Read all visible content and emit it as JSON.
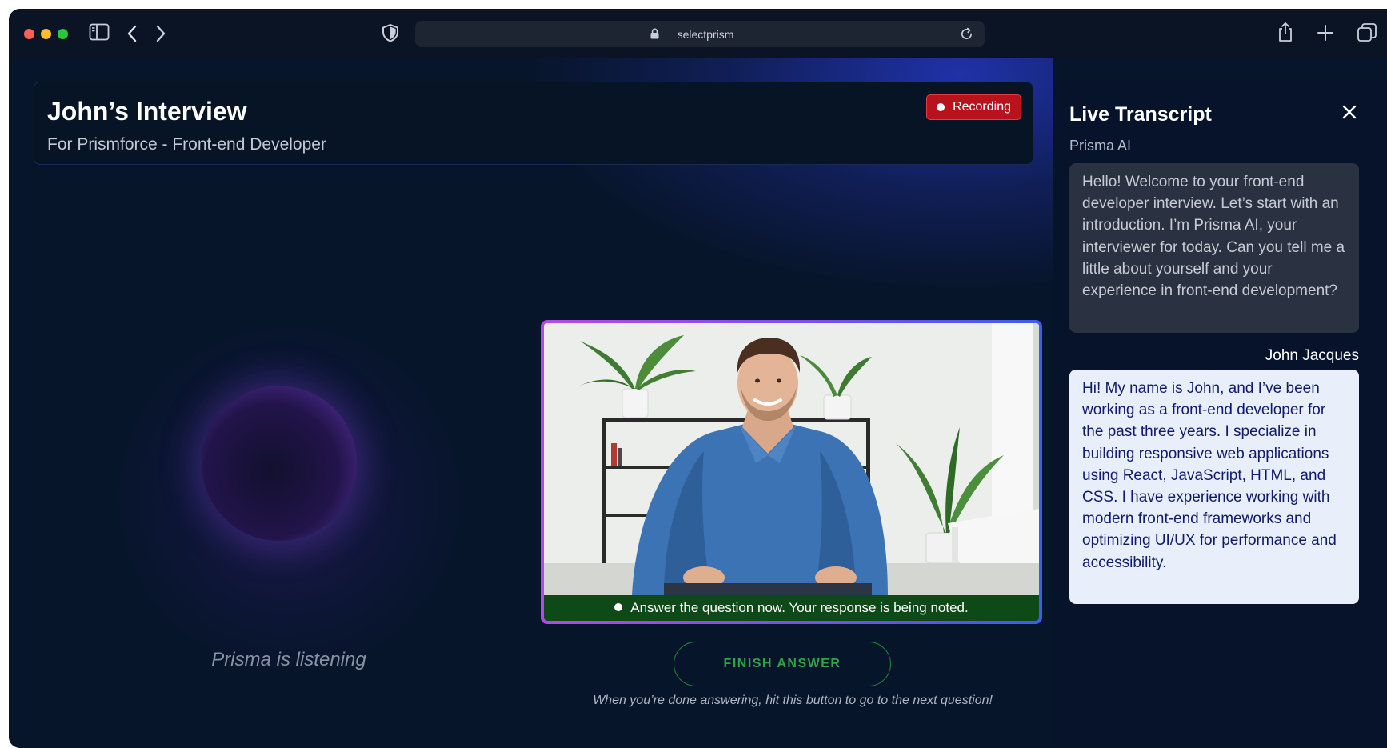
{
  "browser": {
    "url": "selectprism",
    "icons": [
      "sidebar-icon",
      "back-icon",
      "forward-icon",
      "shield-icon",
      "lock-icon",
      "reload-icon",
      "share-icon",
      "new-tab-icon",
      "tabs-icon"
    ]
  },
  "header": {
    "title": "John’s Interview",
    "subtitle": "For Prismforce - Front-end Developer",
    "recording_label": "Recording"
  },
  "assistant": {
    "status": "Prisma is listening"
  },
  "video": {
    "banner": "Answer the question now. Your response is being noted."
  },
  "actions": {
    "finish_label": "FINISH ANSWER",
    "finish_hint": "When you’re done answering, hit this button to go to the next question!"
  },
  "transcript": {
    "title": "Live Transcript",
    "messages": [
      {
        "speaker": "Prisma AI",
        "text": "Hello! Welcome to your front-end developer interview. Let’s start with an introduction. I’m Prisma AI, your interviewer for today. Can you tell me a little about yourself and your experience in front-end development?"
      },
      {
        "speaker": "John Jacques",
        "text": "Hi! My name is John, and I’ve been working as a front-end developer for the past three years. I specialize in building responsive web applications using React, JavaScript, HTML, and CSS. I have experience working with modern front-end frameworks and optimizing UI/UX for performance and accessibility."
      }
    ]
  },
  "colors": {
    "background": "#07152b",
    "recording": "#b8121d",
    "accent_green": "#2fa347",
    "frame_gradient_start": "#b24be6",
    "frame_gradient_end": "#3b5cf5"
  }
}
